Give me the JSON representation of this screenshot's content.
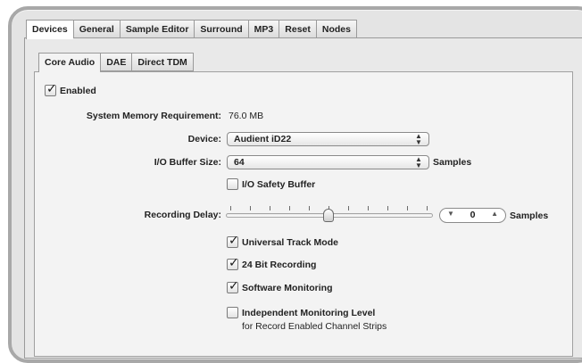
{
  "tabs": [
    "Devices",
    "General",
    "Sample Editor",
    "Surround",
    "MP3",
    "Reset",
    "Nodes"
  ],
  "active_tab": "Devices",
  "subtabs": [
    "Core Audio",
    "DAE",
    "Direct TDM"
  ],
  "active_subtab": "Core Audio",
  "enabled": {
    "label": "Enabled",
    "checked": true
  },
  "memory": {
    "label": "System Memory Requirement:",
    "value": "76.0 MB"
  },
  "device": {
    "label": "Device:",
    "value": "Audient iD22"
  },
  "buffer": {
    "label": "I/O Buffer Size:",
    "value": "64",
    "unit": "Samples"
  },
  "safety_buffer": {
    "label": "I/O Safety Buffer",
    "checked": false
  },
  "recording_delay": {
    "label": "Recording Delay:",
    "value": "0",
    "unit": "Samples",
    "slider_position": 0.5
  },
  "options": [
    {
      "label": "Universal Track Mode",
      "checked": true
    },
    {
      "label": "24 Bit Recording",
      "checked": true
    },
    {
      "label": "Software Monitoring",
      "checked": true
    },
    {
      "label": "Independent Monitoring Level",
      "checked": false
    }
  ],
  "independent_note": "for Record Enabled Channel Strips",
  "check_glyph": "✓",
  "arrows": {
    "popup_up": "▲",
    "popup_down": "▼",
    "step_down": "▼",
    "step_up": "▲"
  }
}
